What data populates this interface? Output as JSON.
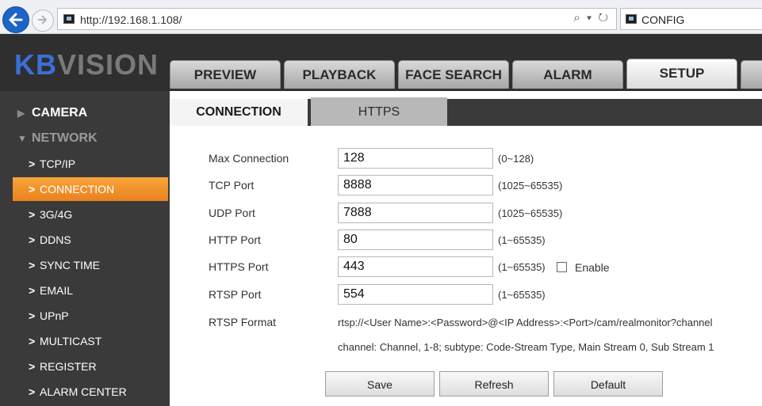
{
  "browser": {
    "url": "http://192.168.1.108/",
    "address_icons": "⌕ ▾ ↻",
    "tab_title": "CONFIG"
  },
  "header": {
    "logo_kb": "KB",
    "logo_vision": "VISION",
    "nav": [
      "PREVIEW",
      "PLAYBACK",
      "FACE SEARCH",
      "ALARM",
      "SETUP"
    ],
    "active_nav": "SETUP"
  },
  "sidebar": {
    "camera": "CAMERA",
    "network": "NETWORK",
    "items": [
      "TCP/IP",
      "CONNECTION",
      "3G/4G",
      "DDNS",
      "SYNC TIME",
      "EMAIL",
      "UPnP",
      "MULTICAST",
      "REGISTER",
      "ALARM CENTER"
    ],
    "active_item": "CONNECTION"
  },
  "subtabs": [
    "CONNECTION",
    "HTTPS"
  ],
  "form": {
    "fields": [
      {
        "label": "Max Connection",
        "value": "128",
        "range": "(0~128)"
      },
      {
        "label": "TCP Port",
        "value": "8888",
        "range": "(1025~65535)"
      },
      {
        "label": "UDP Port",
        "value": "7888",
        "range": "(1025~65535)"
      },
      {
        "label": "HTTP Port",
        "value": "80",
        "range": "(1~65535)"
      },
      {
        "label": "HTTPS Port",
        "value": "443",
        "range": "(1~65535)"
      },
      {
        "label": "RTSP Port",
        "value": "554",
        "range": "(1~65535)"
      }
    ],
    "https_enable_label": "Enable",
    "https_enable_checked": false,
    "rtsp_format_label": "RTSP Format",
    "rtsp_format": "rtsp://<User Name>:<Password>@<IP Address>:<Port>/cam/realmonitor?channel",
    "rtsp_note": "channel: Channel, 1-8; subtype: Code-Stream Type, Main Stream 0, Sub Stream 1"
  },
  "buttons": {
    "save": "Save",
    "refresh": "Refresh",
    "default": "Default"
  },
  "colors": {
    "accent_orange": "#f29a31",
    "logo_blue": "#3b6fd8",
    "sidebar_bg": "#3a3a3a"
  }
}
